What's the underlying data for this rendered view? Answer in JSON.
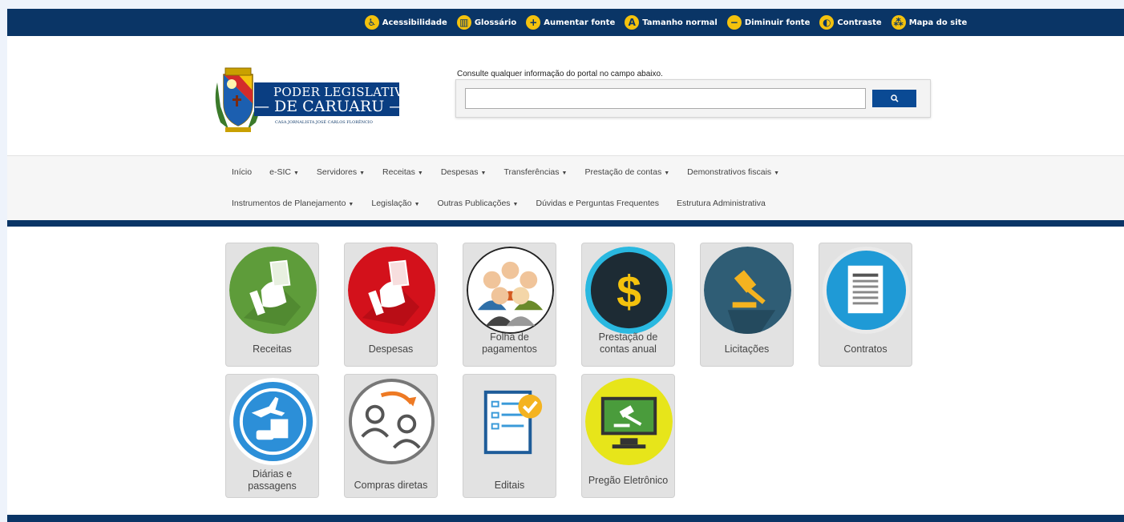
{
  "accessibility": [
    {
      "label": "Acessibilidade",
      "icon": "accessibility-icon",
      "glyph": "♿"
    },
    {
      "label": "Glossário",
      "icon": "book-icon",
      "glyph": "▥"
    },
    {
      "label": "Aumentar fonte",
      "icon": "plus-icon",
      "glyph": "+"
    },
    {
      "label": "Tamanho normal",
      "icon": "font-icon",
      "glyph": "A"
    },
    {
      "label": "Diminuir fonte",
      "icon": "minus-icon",
      "glyph": "−"
    },
    {
      "label": "Contraste",
      "icon": "contrast-icon",
      "glyph": "◐"
    },
    {
      "label": "Mapa do site",
      "icon": "sitemap-icon",
      "glyph": "⁂"
    }
  ],
  "logo": {
    "line1": "PODER LEGISLATIVO",
    "line2": "— DE CARUARU —",
    "subtitle": "CASA JORNALISTA JOSÉ CARLOS FLORÊNCIO"
  },
  "search": {
    "label": "Consulte qualquer informação do portal no campo abaixo.",
    "value": "",
    "button_icon": "search-icon"
  },
  "nav": {
    "row1": [
      {
        "label": "Início",
        "dropdown": false
      },
      {
        "label": "e-SIC",
        "dropdown": true
      },
      {
        "label": "Servidores",
        "dropdown": true
      },
      {
        "label": "Receitas",
        "dropdown": true
      },
      {
        "label": "Despesas",
        "dropdown": true
      },
      {
        "label": "Transferências",
        "dropdown": true
      },
      {
        "label": "Prestação de contas",
        "dropdown": true
      },
      {
        "label": "Demonstrativos fiscais",
        "dropdown": true
      }
    ],
    "row2": [
      {
        "label": "Instrumentos de Planejamento",
        "dropdown": true
      },
      {
        "label": "Legislação",
        "dropdown": true
      },
      {
        "label": "Outras Publicações",
        "dropdown": true
      },
      {
        "label": "Dúvidas e Perguntas Frequentes",
        "dropdown": false
      },
      {
        "label": "Estrutura Administrativa",
        "dropdown": false
      }
    ]
  },
  "tiles": [
    {
      "label": "Receitas",
      "icon": "money-in-hand-icon"
    },
    {
      "label": "Despesas",
      "icon": "money-out-hand-icon"
    },
    {
      "label": "Folha de pagamentos",
      "icon": "people-group-icon"
    },
    {
      "label": "Prestação de contas anual",
      "icon": "dollar-icon"
    },
    {
      "label": "Licitações",
      "icon": "gavel-icon"
    },
    {
      "label": "Contratos",
      "icon": "document-icon"
    },
    {
      "label": "Diárias e passagens",
      "icon": "travel-icon"
    },
    {
      "label": "Compras diretas",
      "icon": "user-transfer-icon"
    },
    {
      "label": "Editais",
      "icon": "checklist-icon"
    },
    {
      "label": "Pregão Eletrônico",
      "icon": "online-auction-icon"
    }
  ],
  "colors": {
    "brand_navy": "#0a3566",
    "accent_yellow": "#f4c20d",
    "button_blue": "#0a4a94"
  }
}
